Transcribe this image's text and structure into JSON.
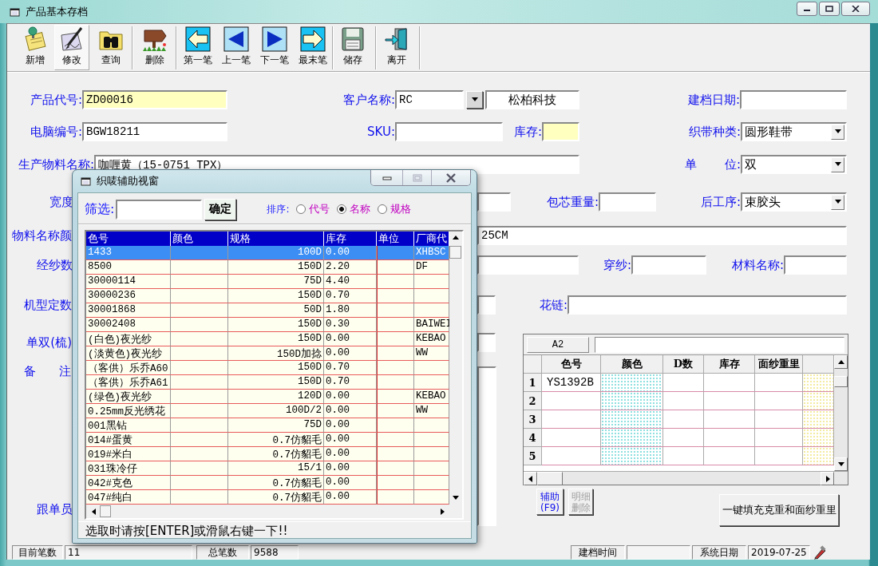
{
  "window": {
    "title": "产品基本存档"
  },
  "toolbar": [
    {
      "label": "新增",
      "selected": false
    },
    {
      "label": "修改",
      "selected": true
    },
    {
      "label": "查询",
      "selected": false
    },
    {
      "label": "删除",
      "selected": false
    },
    {
      "label": "第一笔",
      "selected": false
    },
    {
      "label": "上一笔",
      "selected": false
    },
    {
      "label": "下一笔",
      "selected": false
    },
    {
      "label": "最末笔",
      "selected": false
    },
    {
      "label": "储存",
      "selected": false
    },
    {
      "label": "离开",
      "selected": false
    }
  ],
  "form": {
    "fields": [
      {
        "label": "产品代号:",
        "kind": "text",
        "value": "ZD00016",
        "highlighted": true
      },
      {
        "label": "客户名称:",
        "kind": "lookup",
        "value": "RC",
        "display": "松柏科技"
      },
      {
        "label": "建档日期:",
        "kind": "text",
        "highlighted": false
      },
      {
        "label": "电脑编号:",
        "kind": "text",
        "value": "BGW18211",
        "highlighted": false
      },
      {
        "label": "SKU:",
        "kind": "text",
        "highlighted": false
      },
      {
        "label": "库存:",
        "kind": "text",
        "highlighted": true
      },
      {
        "label": "织带种类:",
        "kind": "combo",
        "value": "圆形鞋带"
      },
      {
        "label": "生产物料名称:",
        "kind": "text",
        "value": "咖喱黄（15-0751 TPX）",
        "highlighted": false
      },
      {
        "label": "单 位:",
        "kind": "combo",
        "value": "双"
      },
      {
        "label": "宽度",
        "kind": "text",
        "highlighted": false
      },
      {
        "label": "包芯重量:",
        "kind": "text",
        "highlighted": false
      },
      {
        "label": "后工序:",
        "kind": "combo",
        "value": "束胶头"
      },
      {
        "label": "物料名称颜",
        "kind": "text",
        "value": "25CM",
        "highlighted": false
      },
      {
        "label": "经纱数",
        "kind": "text",
        "highlighted": false
      },
      {
        "label": "穿纱:",
        "kind": "text",
        "highlighted": false
      },
      {
        "label": "材料名称:",
        "kind": "text",
        "highlighted": false
      },
      {
        "label": "机型定数",
        "kind": "text",
        "highlighted": false
      },
      {
        "label": "花链:",
        "kind": "text",
        "highlighted": false
      },
      {
        "label": "单双(梳)",
        "kind": "text",
        "highlighted": false
      },
      {
        "label": "备 注",
        "kind": "memo"
      },
      {
        "label": "跟单员",
        "kind": "label"
      }
    ]
  },
  "detail_grid": {
    "cell_ref": "A2",
    "columns": [
      "色号",
      "颜色",
      "D数",
      "库存",
      "面纱重里"
    ],
    "rows": [
      {
        "number": "1",
        "code": "YS1392B"
      },
      {
        "number": "2"
      },
      {
        "number": "3"
      },
      {
        "number": "4"
      },
      {
        "number": "5"
      }
    ]
  },
  "grid_buttons": [
    {
      "label": "辅助 (F9)",
      "disabled": false
    },
    {
      "label": "明细删除",
      "disabled": true
    }
  ],
  "fill_button": "一键填充克重和面纱重里",
  "status_bar": [
    {
      "kind": "label",
      "text": "目前笔数"
    },
    {
      "kind": "value",
      "text": "11"
    },
    {
      "kind": "label",
      "text": "总笔数"
    },
    {
      "kind": "value",
      "text": "9588"
    },
    {
      "kind": "label",
      "text": "建档时间"
    },
    {
      "kind": "value"
    },
    {
      "kind": "label",
      "text": "系统日期"
    },
    {
      "kind": "value",
      "text": "2019-07-25"
    }
  ],
  "aux_dialog": {
    "title": "织唛辅助视窗",
    "filter_label": "筛选:",
    "confirm_button": "确定",
    "sort_label": "排序:",
    "sort_options": [
      {
        "label": "代号",
        "selected": false
      },
      {
        "label": "名称",
        "selected": true
      },
      {
        "label": "规格",
        "selected": false
      }
    ],
    "columns": [
      "色号",
      "颜色",
      "规格",
      "库存",
      "单位",
      "厂商代"
    ],
    "rows": [
      {
        "code": "1433",
        "spec": "100D",
        "stock": "0.00",
        "vendor": "XHBSC",
        "selected": true
      },
      {
        "code": "8500",
        "spec": "150D",
        "stock": "2.20",
        "vendor": "DF",
        "selected": false
      },
      {
        "code": "30000114",
        "spec": "75D",
        "stock": "4.40",
        "selected": false
      },
      {
        "code": "30000236",
        "spec": "150D",
        "stock": "0.70",
        "selected": false
      },
      {
        "code": "30001868",
        "spec": "50D",
        "stock": "1.80",
        "selected": false
      },
      {
        "code": "30002408",
        "spec": "150D",
        "stock": "0.30",
        "vendor": "BAIWEI",
        "selected": false
      },
      {
        "code": "(白色)夜光纱",
        "spec": "150D",
        "stock": "0.00",
        "vendor": "KEBAO",
        "selected": false
      },
      {
        "code": "(淡黄色)夜光纱",
        "spec": "150D加捻",
        "stock": "0.00",
        "vendor": "WW",
        "selected": false
      },
      {
        "code": "（客供）乐乔A60",
        "spec": "150D",
        "stock": "0.70",
        "selected": false
      },
      {
        "code": "（客供）乐乔A61",
        "spec": "150D",
        "stock": "0.70",
        "selected": false
      },
      {
        "code": "(绿色)夜光纱",
        "spec": "120D",
        "stock": "0.00",
        "vendor": "KEBAO",
        "selected": false
      },
      {
        "code": "0.25mm反光绣花",
        "spec": "100D/2",
        "stock": "0.00",
        "vendor": "WW",
        "selected": false
      },
      {
        "code": "001黑钻",
        "spec": "75D",
        "stock": "0.00",
        "selected": false
      },
      {
        "code": "014#蛋黄",
        "spec": "0.7仿貂毛",
        "stock": "0.00",
        "selected": false
      },
      {
        "code": "019#米白",
        "spec": "0.7仿貂毛",
        "stock": "0.00",
        "selected": false
      },
      {
        "code": "031珠冷仔",
        "spec": "15/1",
        "stock": "0.00",
        "selected": false
      },
      {
        "code": "042#克色",
        "spec": "0.7仿貂毛",
        "stock": "0.00",
        "selected": false
      },
      {
        "code": "047#纯白",
        "spec": "0.7仿貂毛",
        "stock": "0.00",
        "selected": false
      }
    ],
    "hint": "选取时请按[ENTER]或滑鼠右键一下!!"
  }
}
